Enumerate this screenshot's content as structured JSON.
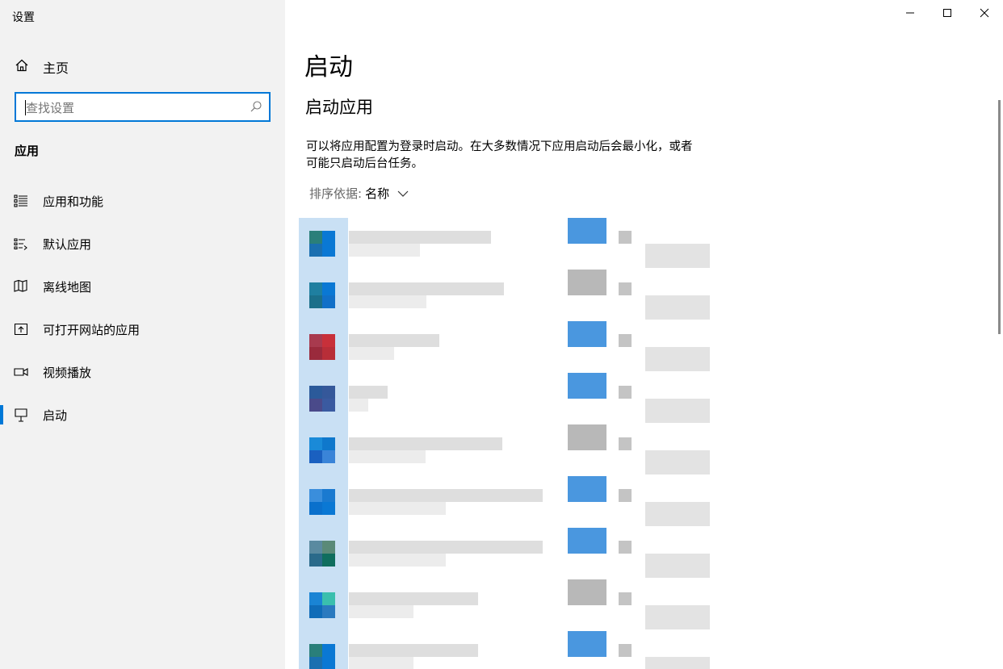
{
  "window": {
    "app_title": "设置"
  },
  "sidebar": {
    "home_label": "主页",
    "search_placeholder": "查找设置",
    "section_title": "应用",
    "items": [
      {
        "label": "应用和功能",
        "icon": "apps-features-icon"
      },
      {
        "label": "默认应用",
        "icon": "default-apps-icon"
      },
      {
        "label": "离线地图",
        "icon": "offline-maps-icon"
      },
      {
        "label": "可打开网站的应用",
        "icon": "apps-for-websites-icon"
      },
      {
        "label": "视频播放",
        "icon": "video-playback-icon"
      },
      {
        "label": "启动",
        "icon": "startup-icon",
        "active": true
      }
    ]
  },
  "main": {
    "page_title": "启动",
    "section_title": "启动应用",
    "description": "可以将应用配置为登录时启动。在大多数情况下应用启动后会最小化，或者可能只启动后台任务。",
    "sort_label": "排序依据:",
    "sort_value": "名称"
  },
  "colors": {
    "accent": "#0078d7",
    "sidebar_bg": "#f2f2f2",
    "content_bg": "#ffffff"
  }
}
